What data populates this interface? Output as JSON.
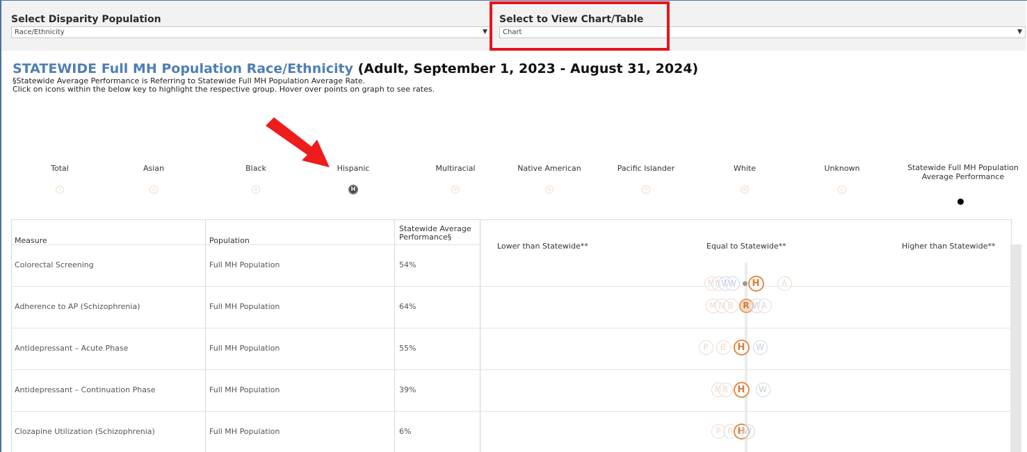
{
  "filters": {
    "disparity": {
      "label": "Select Disparity Population",
      "value": "Race/Ethnicity"
    },
    "view": {
      "label": "Select to View Chart/Table",
      "value": "Chart"
    }
  },
  "title": {
    "main": "STATEWIDE Full MH Population Race/Ethnicity",
    "sub": " (Adult, September 1, 2023 - August 31, 2024)",
    "note1": "§Statewide Average Performance is Referring to Statewide Full MH Population Average Rate.",
    "note2": "Click on icons within the below key to highlight the respective group. Hover over points on graph to see rates."
  },
  "legend": [
    {
      "label": "Total",
      "letter": "T",
      "active": false
    },
    {
      "label": "Asian",
      "letter": "A",
      "active": false
    },
    {
      "label": "Black",
      "letter": "B",
      "active": false
    },
    {
      "label": "Hispanic",
      "letter": "H",
      "active": true
    },
    {
      "label": "Multiracial",
      "letter": "M",
      "active": false
    },
    {
      "label": "Native American",
      "letter": "N",
      "active": false
    },
    {
      "label": "Pacific Islander",
      "letter": "P",
      "active": false
    },
    {
      "label": "White",
      "letter": "W",
      "active": false
    },
    {
      "label": "Unknown",
      "letter": "U",
      "active": false
    }
  ],
  "legend_avg": "Statewide Full MH Population Average Performance",
  "table": {
    "headers": {
      "measure": "Measure",
      "population": "Population",
      "avg": "Statewide Average Performance§",
      "lower": "Lower than Statewide**",
      "equal": "Equal to Statewide**",
      "higher": "Higher than Statewide**"
    },
    "rows": [
      {
        "measure": "Colorectal Screening",
        "population": "Full MH Population",
        "avg": "54%"
      },
      {
        "measure": "Adherence to AP (Schizophrenia)",
        "population": "Full MH Population",
        "avg": "64%"
      },
      {
        "measure": "Antidepressant – Acute Phase",
        "population": "Full MH Population",
        "avg": "55%"
      },
      {
        "measure": "Antidepressant – Continuation Phase",
        "population": "Full MH Population",
        "avg": "39%"
      },
      {
        "measure": "Clozapine Utilization (Schizophrenia)",
        "population": "Full MH Population",
        "avg": "6%"
      }
    ]
  },
  "markers": {
    "h": "H",
    "a": "A",
    "m": "M",
    "n": "N",
    "w": "W",
    "b": "B",
    "p": "P",
    "r": "R"
  },
  "colors": {
    "accent": "#4f7fb3",
    "hispanic": "#e07a32",
    "highlight": "#e8141a"
  }
}
